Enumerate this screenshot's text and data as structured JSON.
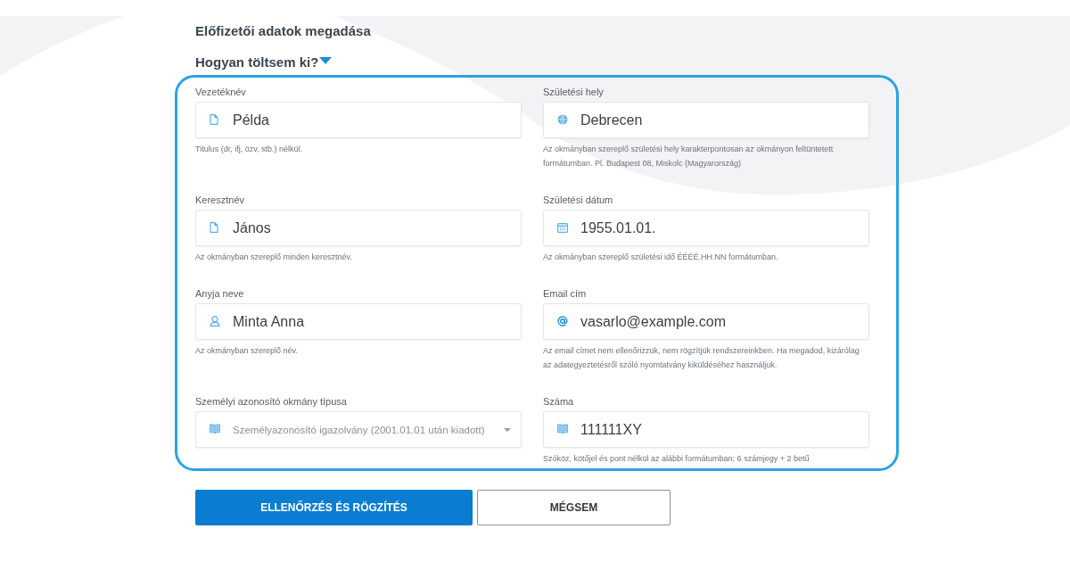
{
  "page_title": "Előfizetői adatok megadása",
  "help_toggle": {
    "label": "Hogyan töltsem ki?"
  },
  "form": {
    "columns": [
      {
        "fields": [
          {
            "kind": "name",
            "label": "Vezetéknév",
            "value": "Példa",
            "disabled": false,
            "hint": "Titulus (dr, ifj, özv, stb.) nélkül."
          },
          {
            "kind": "name",
            "label": "Keresztnév",
            "value": "János",
            "disabled": false,
            "hint": "Az okmányban szereplő minden keresztnév."
          },
          {
            "kind": "person",
            "label": "Anyja neve",
            "value": "Minta Anna",
            "disabled": false,
            "hint": "Az okmányban szereplő név."
          },
          {
            "kind": "select",
            "label": "Személyi azonosító okmány típusa",
            "value": "Személyazonosító igazolvány (2001.01.01 után kiadott)",
            "disabled": true
          }
        ]
      },
      {
        "fields": [
          {
            "kind": "place",
            "label": "Születési hely",
            "value": "Debrecen",
            "disabled": false,
            "hint": "Az okmányban szereplő születési hely karakterpontosan az okmányon feltüntetett formátumban. Pl. Budapest 08, Miskolc (Magyarország)"
          },
          {
            "kind": "date",
            "label": "Születési dátum",
            "value": "1955.01.01.",
            "disabled": false,
            "hint": "Az okmányban szereplő születési idő ÉÉÉÉ.HH.NN formátumban."
          },
          {
            "kind": "email",
            "label": "Email cím",
            "value": "vasarlo@example.com",
            "disabled": false,
            "hint": "Az email címet nem ellenőrizzük, nem rögzítjük rendszereinkben. Ha megadod, kizárólag az adategyeztetésről szóló nyomtatvány kiküldéséhez használjuk."
          },
          {
            "kind": "number",
            "label": "Száma",
            "value": "111111XY",
            "disabled": false,
            "hint": "Szóköz, kötőjel és pont nélkül az alábbi formátumban: 6 számjegy + 2 betű"
          }
        ]
      }
    ]
  },
  "buttons": [
    {
      "kind": "primary",
      "label": "ELLENŐRZÉS ÉS RÖGZÍTÉS"
    },
    {
      "kind": "secondary",
      "label": "MÉGSEM"
    }
  ]
}
